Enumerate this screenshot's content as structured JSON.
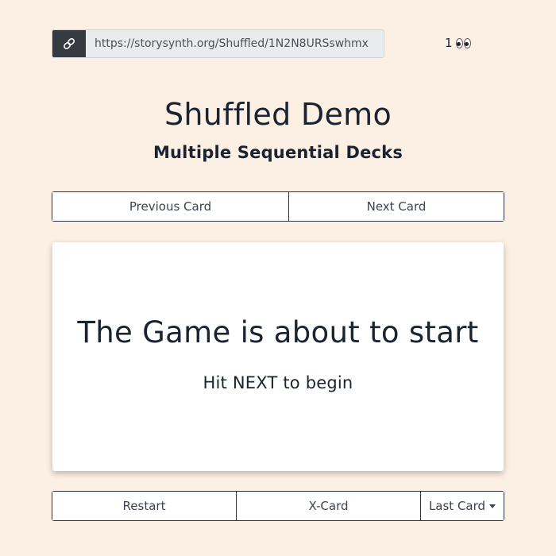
{
  "url_bar": {
    "url": "https://storysynth.org/Shuffled/1N2N8URSswhmx",
    "icon": "link-icon"
  },
  "viewers": {
    "count": "1",
    "icon": "eyes-icon"
  },
  "header": {
    "title": "Shuffled Demo",
    "subtitle": "Multiple Sequential Decks"
  },
  "navigation": {
    "previous_label": "Previous Card",
    "next_label": "Next Card"
  },
  "card": {
    "heading": "The Game is about to start",
    "text": "Hit NEXT to begin"
  },
  "controls": {
    "restart_label": "Restart",
    "xcard_label": "X-Card",
    "last_card_label": "Last Card"
  },
  "colors": {
    "background": "#fcefe4",
    "text": "#1a2330",
    "url_icon_bg": "#343a40",
    "url_field_bg": "#e9ecef"
  }
}
